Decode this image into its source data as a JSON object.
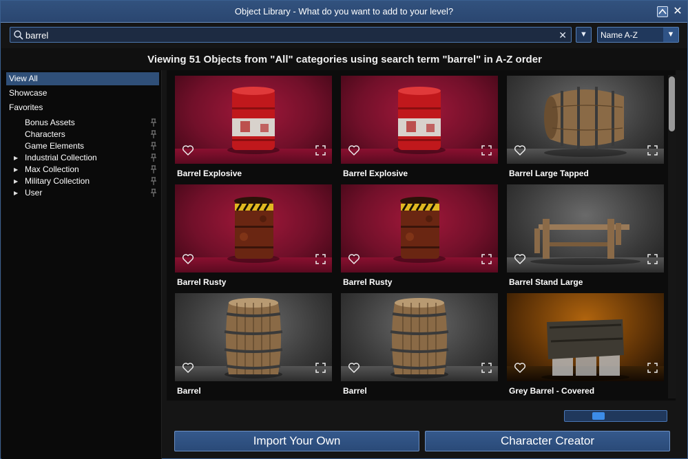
{
  "window": {
    "title": "Object Library - What do you want to add to your level?",
    "accent_color": "#2f5386"
  },
  "search": {
    "value": "barrel",
    "placeholder": ""
  },
  "sort": {
    "selected": "Name A-Z"
  },
  "header": {
    "viewing_text": "Viewing 51 Objects from \"All\" categories using search term \"barrel\" in A-Z order"
  },
  "sidebar": {
    "items": [
      {
        "label": "View All",
        "active": true
      },
      {
        "label": "Showcase",
        "active": false
      },
      {
        "label": "Favorites",
        "active": false
      }
    ],
    "sub_items": [
      {
        "label": "Bonus Assets",
        "expandable": false
      },
      {
        "label": "Characters",
        "expandable": false
      },
      {
        "label": "Game Elements",
        "expandable": false
      },
      {
        "label": "Industrial Collection",
        "expandable": true
      },
      {
        "label": "Max Collection",
        "expandable": true
      },
      {
        "label": "Military Collection",
        "expandable": true
      },
      {
        "label": "User",
        "expandable": true
      }
    ]
  },
  "objects": [
    {
      "label": "Barrel Explosive",
      "theme": "red",
      "model": "red-barrel"
    },
    {
      "label": "Barrel Explosive",
      "theme": "red",
      "model": "red-barrel"
    },
    {
      "label": "Barrel Large Tapped",
      "theme": "grey",
      "model": "wood-barrel-side"
    },
    {
      "label": "Barrel Rusty",
      "theme": "red",
      "model": "rusty-barrel"
    },
    {
      "label": "Barrel Rusty",
      "theme": "red",
      "model": "rusty-barrel"
    },
    {
      "label": "Barrel Stand Large",
      "theme": "grey",
      "model": "barrel-stand"
    },
    {
      "label": "Barrel",
      "theme": "grey",
      "model": "wood-barrel"
    },
    {
      "label": "Barrel",
      "theme": "grey",
      "model": "wood-barrel"
    },
    {
      "label": "Grey Barrel - Covered",
      "theme": "orange",
      "model": "covered-barrels"
    }
  ],
  "pagination": {
    "position": 0.3
  },
  "footer": {
    "import_label": "Import Your Own",
    "creator_label": "Character Creator"
  }
}
